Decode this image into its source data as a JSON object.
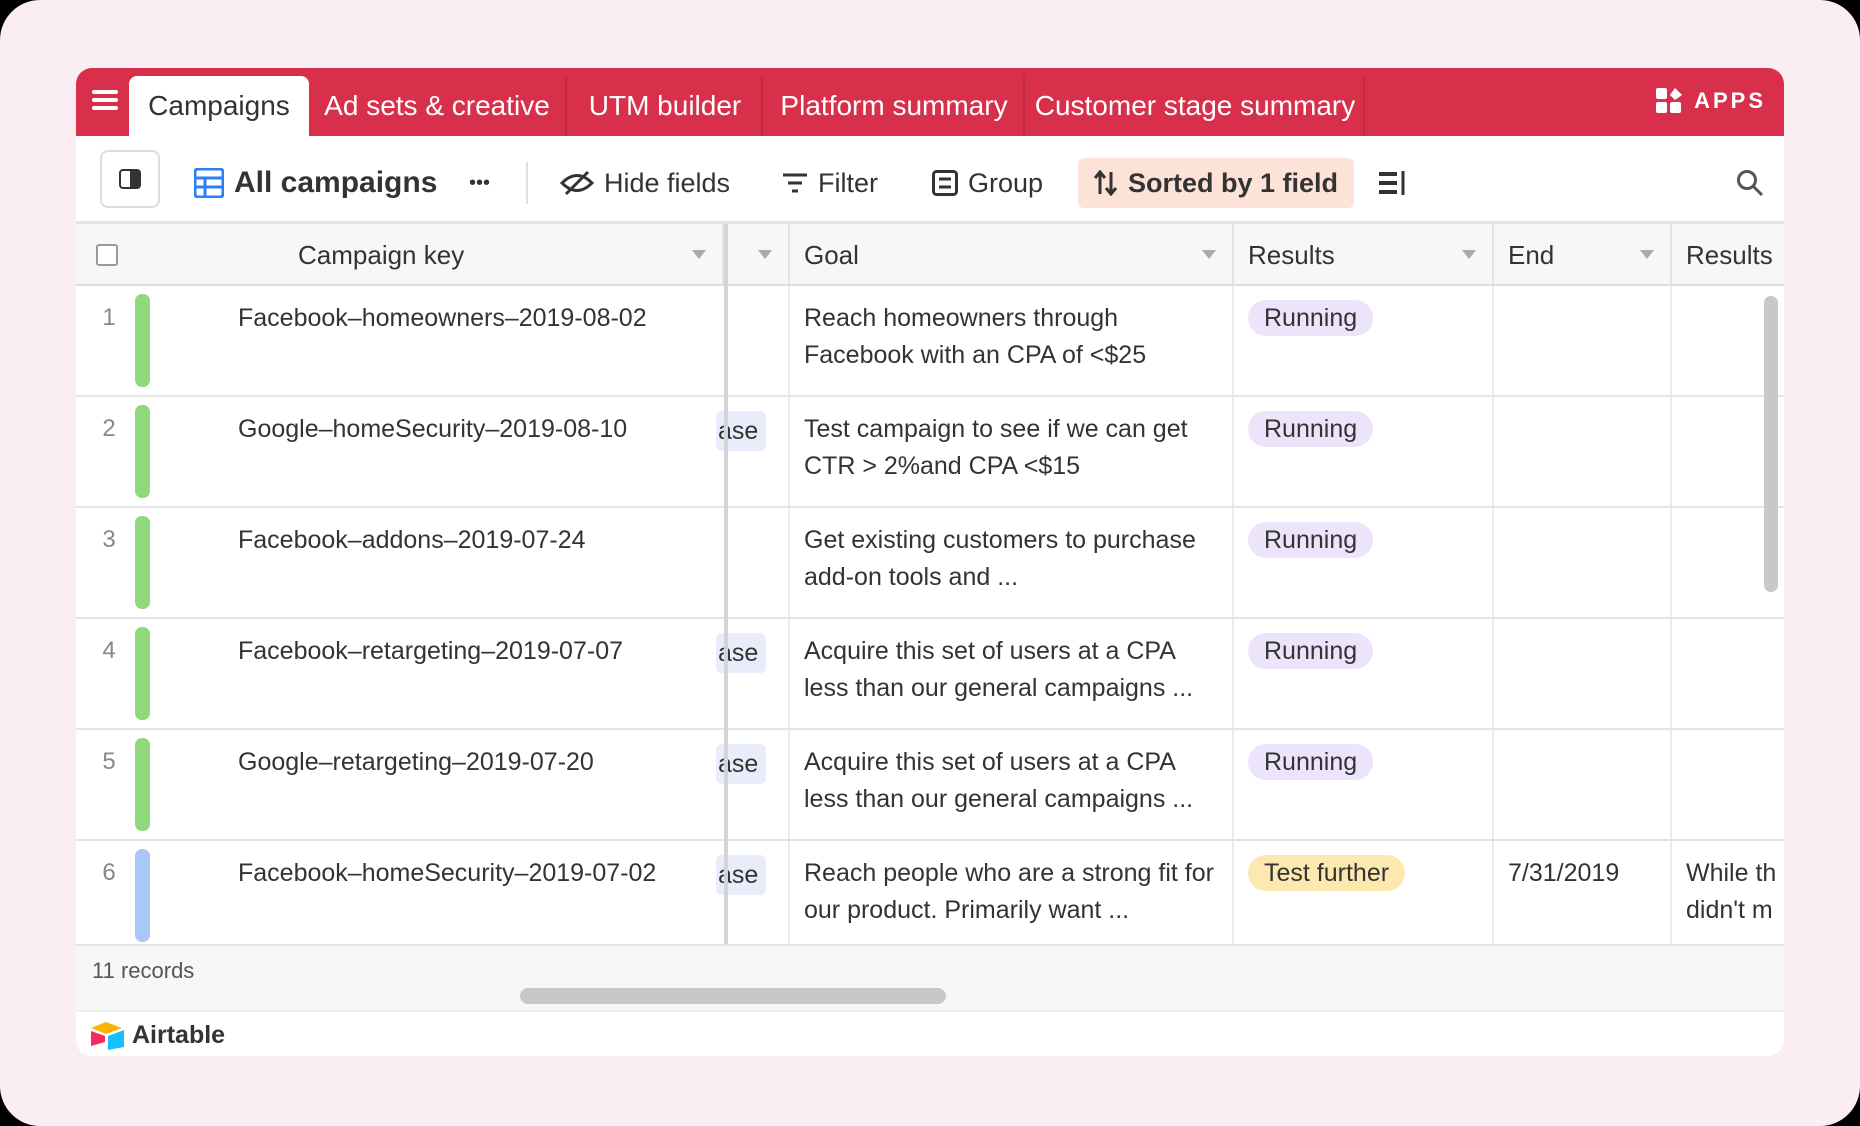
{
  "tabs": [
    {
      "label": "Campaigns",
      "active": true
    },
    {
      "label": "Ad sets & creative"
    },
    {
      "label": "UTM builder"
    },
    {
      "label": "Platform summary"
    },
    {
      "label": "Customer stage summary"
    }
  ],
  "apps_label": "APPS",
  "toolbar": {
    "view_name": "All campaigns",
    "more": "•••",
    "hide_fields": "Hide fields",
    "filter": "Filter",
    "group": "Group",
    "sorted": "Sorted by 1 field"
  },
  "columns": {
    "campaign_key": "Campaign key",
    "goal": "Goal",
    "results": "Results",
    "end": "End",
    "results2": "Results"
  },
  "rows": [
    {
      "num": "1",
      "key": "Facebook–homeowners–2019-08-02",
      "stage": "",
      "goal": "Reach homeowners through Facebook with an CPA of <$25",
      "result": "Running",
      "end": "",
      "results2": ""
    },
    {
      "num": "2",
      "key": "Google–homeSecurity–2019-08-10",
      "stage": "ase",
      "goal": "Test campaign to see if we can get CTR > 2%and CPA <$15",
      "result": "Running",
      "end": "",
      "results2": ""
    },
    {
      "num": "3",
      "key": "Facebook–addons–2019-07-24",
      "stage": "",
      "goal": "Get existing customers to purchase add-on tools and ...",
      "result": "Running",
      "end": "",
      "results2": ""
    },
    {
      "num": "4",
      "key": "Facebook–retargeting–2019-07-07",
      "stage": "ase",
      "goal": "Acquire this set of users at a CPA less than our general campaigns ...",
      "result": "Running",
      "end": "",
      "results2": ""
    },
    {
      "num": "5",
      "key": "Google–retargeting–2019-07-20",
      "stage": "ase",
      "goal": "Acquire this set of users at a CPA less than our general campaigns ...",
      "result": "Running",
      "end": "",
      "results2": ""
    },
    {
      "num": "6",
      "key": "Facebook–homeSecurity–2019-07-02",
      "stage": "ase",
      "goal": "Reach people who are a strong fit for our product. Primarily want ...",
      "result": "Test further",
      "end": "7/31/2019",
      "results2": "While th didn't m"
    }
  ],
  "records_count": "11 records",
  "brand": "Airtable",
  "colors": {
    "accent": "#d8304b",
    "green_bar": "#8fd87b",
    "blue_bar": "#a9c8f7",
    "running_pill": "#ece4fb",
    "test_further_pill": "#fde8b0",
    "sorted_bg": "#fde2d8"
  },
  "icons": {
    "menu": "hamburger-icon",
    "apps": "apps-icon",
    "sidebar": "sidebar-toggle-icon",
    "grid": "grid-view-icon",
    "hide": "hide-fields-icon",
    "filter": "filter-icon",
    "group": "group-icon",
    "sort": "sort-icon",
    "rowheight": "row-height-icon",
    "search": "search-icon"
  }
}
